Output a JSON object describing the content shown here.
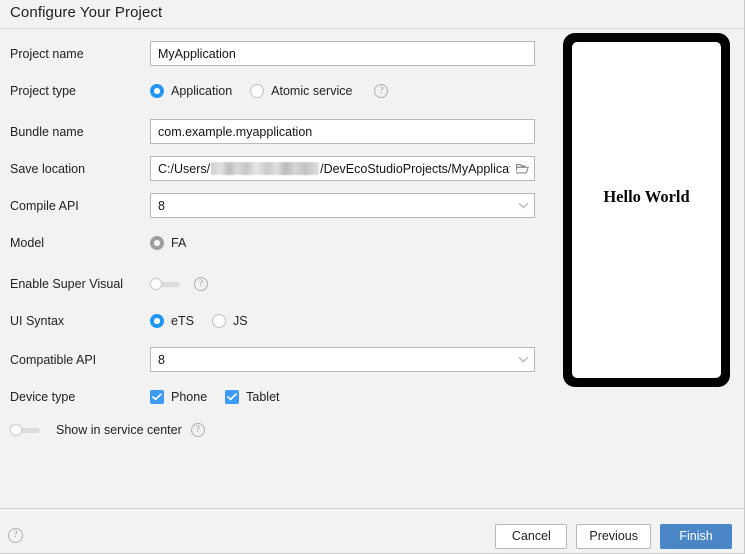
{
  "dialog": {
    "title": "Configure Your Project"
  },
  "fields": {
    "project_name": {
      "label": "Project name",
      "value": "MyApplication"
    },
    "project_type": {
      "label": "Project type",
      "options": [
        {
          "label": "Application",
          "selected": true
        },
        {
          "label": "Atomic service",
          "selected": false
        }
      ],
      "help": "?"
    },
    "bundle_name": {
      "label": "Bundle name",
      "value": "com.example.myapplication"
    },
    "save_location": {
      "label": "Save location",
      "prefix": "C:/Users/",
      "suffix": "/DevEcoStudioProjects/MyApplicat",
      "folder_icon": "folder-icon"
    },
    "compile_api": {
      "label": "Compile API",
      "value": "8",
      "chevron": "chevron-down-icon"
    },
    "model": {
      "label": "Model",
      "options": [
        {
          "label": "FA",
          "selected": true
        }
      ]
    },
    "enable_super_visual": {
      "label": "Enable Super Visual",
      "checked": false,
      "help": "?"
    },
    "ui_syntax": {
      "label": "UI Syntax",
      "options": [
        {
          "label": "eTS",
          "selected": true
        },
        {
          "label": "JS",
          "selected": false
        }
      ]
    },
    "compatible_api": {
      "label": "Compatible API",
      "value": "8",
      "chevron": "chevron-down-icon"
    },
    "device_type": {
      "label": "Device type",
      "options": [
        {
          "label": "Phone",
          "checked": true
        },
        {
          "label": "Tablet",
          "checked": true
        }
      ]
    },
    "show_in_service_center": {
      "label": "Show in service center",
      "checked": false,
      "help": "?"
    }
  },
  "preview": {
    "text": "Hello World"
  },
  "footer": {
    "help": "?",
    "cancel": "Cancel",
    "previous": "Previous",
    "finish": "Finish"
  },
  "colors": {
    "accent": "#2196f3",
    "checkbox": "#3d9bf5",
    "primary_button": "#4a86c5",
    "background": "#f2f2f2"
  }
}
